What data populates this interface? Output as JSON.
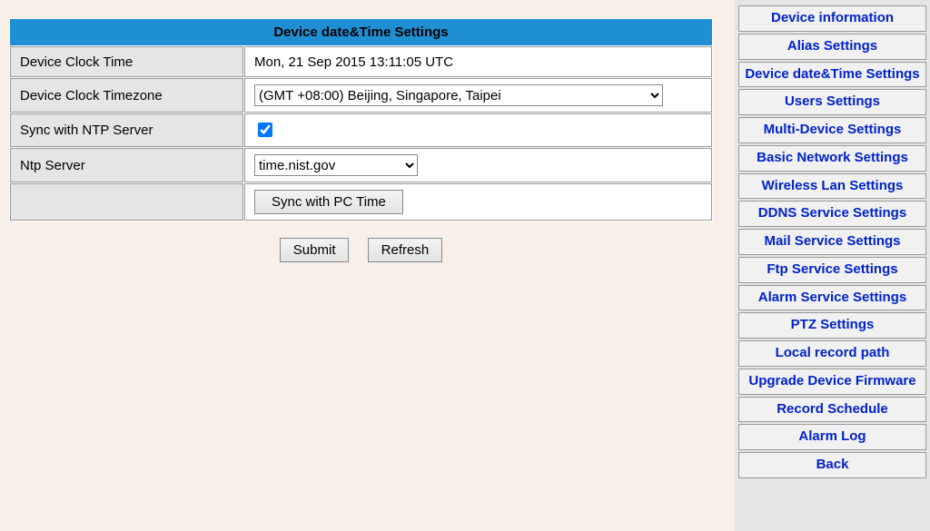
{
  "header": "Device date&Time Settings",
  "rows": {
    "clock_time": {
      "label": "Device Clock Time",
      "value": "Mon, 21 Sep 2015 13:11:05 UTC"
    },
    "timezone": {
      "label": "Device Clock Timezone",
      "selected": "(GMT +08:00) Beijing, Singapore, Taipei"
    },
    "ntp_sync": {
      "label": "Sync with NTP Server",
      "checked": true
    },
    "ntp_server": {
      "label": "Ntp Server",
      "selected": "time.nist.gov"
    }
  },
  "buttons": {
    "sync_pc": "Sync with PC Time",
    "submit": "Submit",
    "refresh": "Refresh"
  },
  "sidebar": {
    "items": [
      "Device information",
      "Alias Settings",
      "Device date&Time Settings",
      "Users Settings",
      "Multi-Device Settings",
      "Basic Network Settings",
      "Wireless Lan Settings",
      "DDNS Service Settings",
      "Mail Service Settings",
      "Ftp Service Settings",
      "Alarm Service Settings",
      "PTZ Settings",
      "Local record path",
      "Upgrade Device Firmware",
      "Record Schedule",
      "Alarm Log",
      "Back"
    ]
  }
}
